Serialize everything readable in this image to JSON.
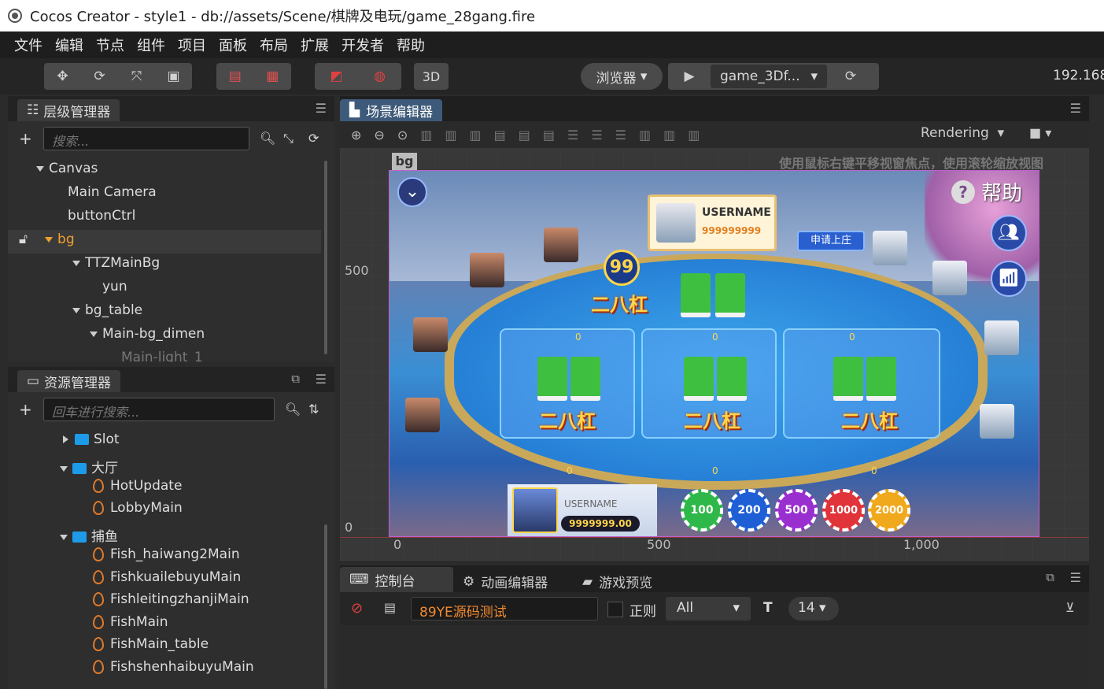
{
  "window": {
    "title": "Cocos Creator - style1 - db://assets/Scene/棋牌及电玩/game_28gang.fire"
  },
  "menu": [
    "文件",
    "编辑",
    "节点",
    "组件",
    "项目",
    "面板",
    "布局",
    "扩展",
    "开发者",
    "帮助"
  ],
  "toolbar": {
    "btn3d": "3D",
    "browser": "浏览器",
    "scene_select": "game_3Df...",
    "ip": "192.168"
  },
  "hierarchy": {
    "title": "层级管理器",
    "search_placeholder": "搜索...",
    "nodes": [
      {
        "label": "Canvas"
      },
      {
        "label": "Main Camera"
      },
      {
        "label": "buttonCtrl"
      },
      {
        "label": "bg"
      },
      {
        "label": "TTZMainBg"
      },
      {
        "label": "yun"
      },
      {
        "label": "bg_table"
      },
      {
        "label": "Main-bg_dimen"
      },
      {
        "label": "Main-light_1"
      }
    ]
  },
  "assets": {
    "title": "资源管理器",
    "search_placeholder": "回车进行搜索...",
    "items": [
      {
        "label": "Slot"
      },
      {
        "label": "大厅"
      },
      {
        "label": "HotUpdate"
      },
      {
        "label": "LobbyMain"
      },
      {
        "label": "捕鱼"
      },
      {
        "label": "Fish_haiwang2Main"
      },
      {
        "label": "FishkuailebuyuMain"
      },
      {
        "label": "FishleitingzhanjiMain"
      },
      {
        "label": "FishMain"
      },
      {
        "label": "FishMain_table"
      },
      {
        "label": "FishshenhaibuyuMain"
      }
    ]
  },
  "scene_editor": {
    "title": "场景编辑器",
    "rendering": "Rendering",
    "hint": "使用鼠标右键平移视窗焦点，使用滚轮缩放视图",
    "node_tag": "bg",
    "y_axis": [
      "500",
      "0"
    ],
    "x_axis": [
      "0",
      "500",
      "1,000"
    ]
  },
  "game": {
    "help": "帮助",
    "banker_name": "USERNAME",
    "banker_coins": "999999999",
    "apply_banker": "申请上庄",
    "round": "99",
    "center_label": "二八杠",
    "zone_label": "二八杠",
    "zone_values": [
      "0",
      "0",
      "0"
    ],
    "bottom_values": [
      "0",
      "0",
      "0"
    ],
    "player_name": "USERNAME",
    "player_coins": "9999999.00",
    "chips": [
      "100",
      "200",
      "500",
      "1000",
      "2000"
    ],
    "chip_colors": [
      "#2fb84a",
      "#1e5fd6",
      "#9a2fd0",
      "#e0343a",
      "#f0a81c"
    ]
  },
  "console": {
    "tabs": [
      "控制台",
      "动画编辑器",
      "游戏预览"
    ],
    "filter_text": "89YE源码测试",
    "regex_label": "正则",
    "level": "All",
    "font_size": "14"
  }
}
